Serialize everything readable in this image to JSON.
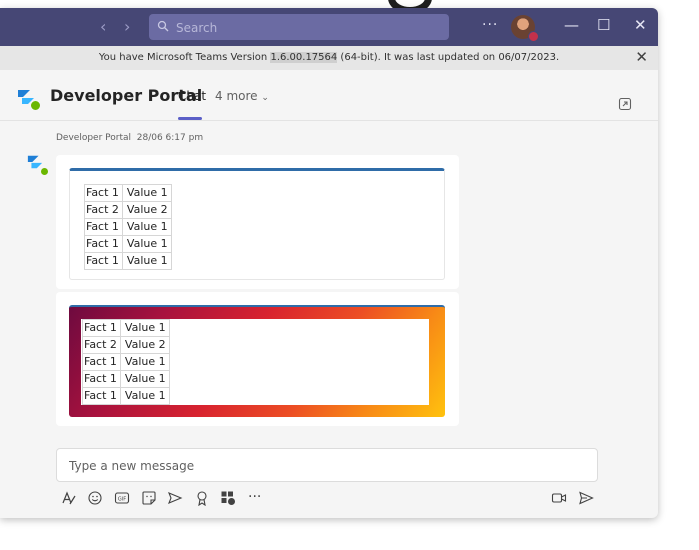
{
  "search": {
    "placeholder": "Search"
  },
  "banner": {
    "prefix": "You have Microsoft Teams Version ",
    "version": "1.6.00.17564",
    "suffix": " (64-bit). It was last updated on 06/07/2023."
  },
  "header": {
    "title": "Developer Portal",
    "tabs": {
      "chat": "Chat",
      "more": "4 more"
    }
  },
  "message": {
    "sender": "Developer Portal",
    "time": "28/06 6:17 pm",
    "card1_facts": [
      {
        "fact": "Fact 1",
        "value": "Value 1"
      },
      {
        "fact": "Fact 2",
        "value": "Value 2"
      },
      {
        "fact": "Fact 1",
        "value": "Value 1"
      },
      {
        "fact": "Fact 1",
        "value": "Value 1"
      },
      {
        "fact": "Fact 1",
        "value": "Value 1"
      }
    ],
    "card2_facts": [
      {
        "fact": "Fact 1",
        "value": "Value 1"
      },
      {
        "fact": "Fact 2",
        "value": "Value 2"
      },
      {
        "fact": "Fact 1",
        "value": "Value 1"
      },
      {
        "fact": "Fact 1",
        "value": "Value 1"
      },
      {
        "fact": "Fact 1",
        "value": "Value 1"
      }
    ]
  },
  "compose": {
    "placeholder": "Type a new message"
  },
  "colors": {
    "titlebar": "#464775",
    "accent": "#5b5fc7",
    "card_border": "#2f6ca8",
    "presence": "#6bb700"
  }
}
